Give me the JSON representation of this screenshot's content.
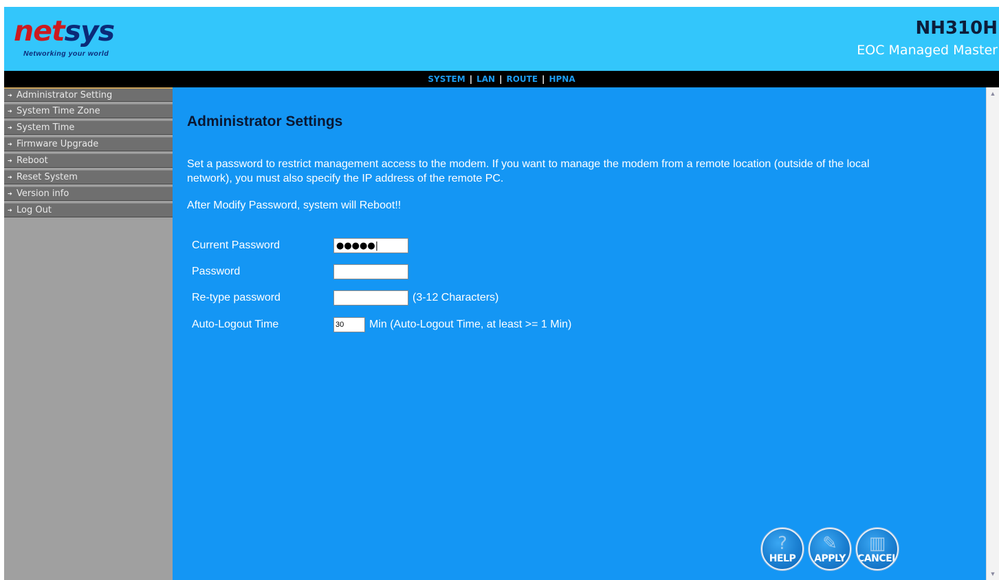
{
  "header": {
    "logo_net": "net",
    "logo_sys": "sys",
    "logo_tagline": "Networking your world",
    "model": "NH310H",
    "subtitle": "EOC Managed Master"
  },
  "topnav": {
    "items": [
      "SYSTEM",
      "LAN",
      "ROUTE",
      "HPNA"
    ],
    "separator": "|"
  },
  "sidebar": {
    "items": [
      {
        "label": "Administrator Setting"
      },
      {
        "label": "System Time Zone"
      },
      {
        "label": "System Time"
      },
      {
        "label": "Firmware Upgrade"
      },
      {
        "label": "Reboot"
      },
      {
        "label": "Reset System"
      },
      {
        "label": "Version info"
      },
      {
        "label": "Log Out"
      }
    ]
  },
  "main": {
    "title": "Administrator Settings",
    "description": "Set a password to restrict management access to the modem. If you want to manage the modem from a remote location (outside of the local network), you must also specify the IP address of the remote PC.",
    "reboot_note": "After Modify Password, system will Reboot!!",
    "form": {
      "current_password_label": "Current Password",
      "current_password_value": "●●●●●|",
      "password_label": "Password",
      "password_value": "",
      "retype_label": "Re-type password",
      "retype_value": "",
      "retype_hint": "(3-12 Characters)",
      "logout_label": "Auto-Logout Time",
      "logout_value": "30",
      "logout_hint": "Min (Auto-Logout Time, at least >= 1 Min)"
    }
  },
  "buttons": {
    "help": "HELP",
    "apply": "APPLY",
    "cancel": "CANCEL"
  },
  "colors": {
    "header_bg": "#33c6fb",
    "content_bg": "#1496f4",
    "sidebar_bg": "#a0a0a0",
    "sidebar_item_bg": "#6f6f6f",
    "logo_red": "#cc1a1f",
    "logo_blue": "#0b2a78"
  }
}
